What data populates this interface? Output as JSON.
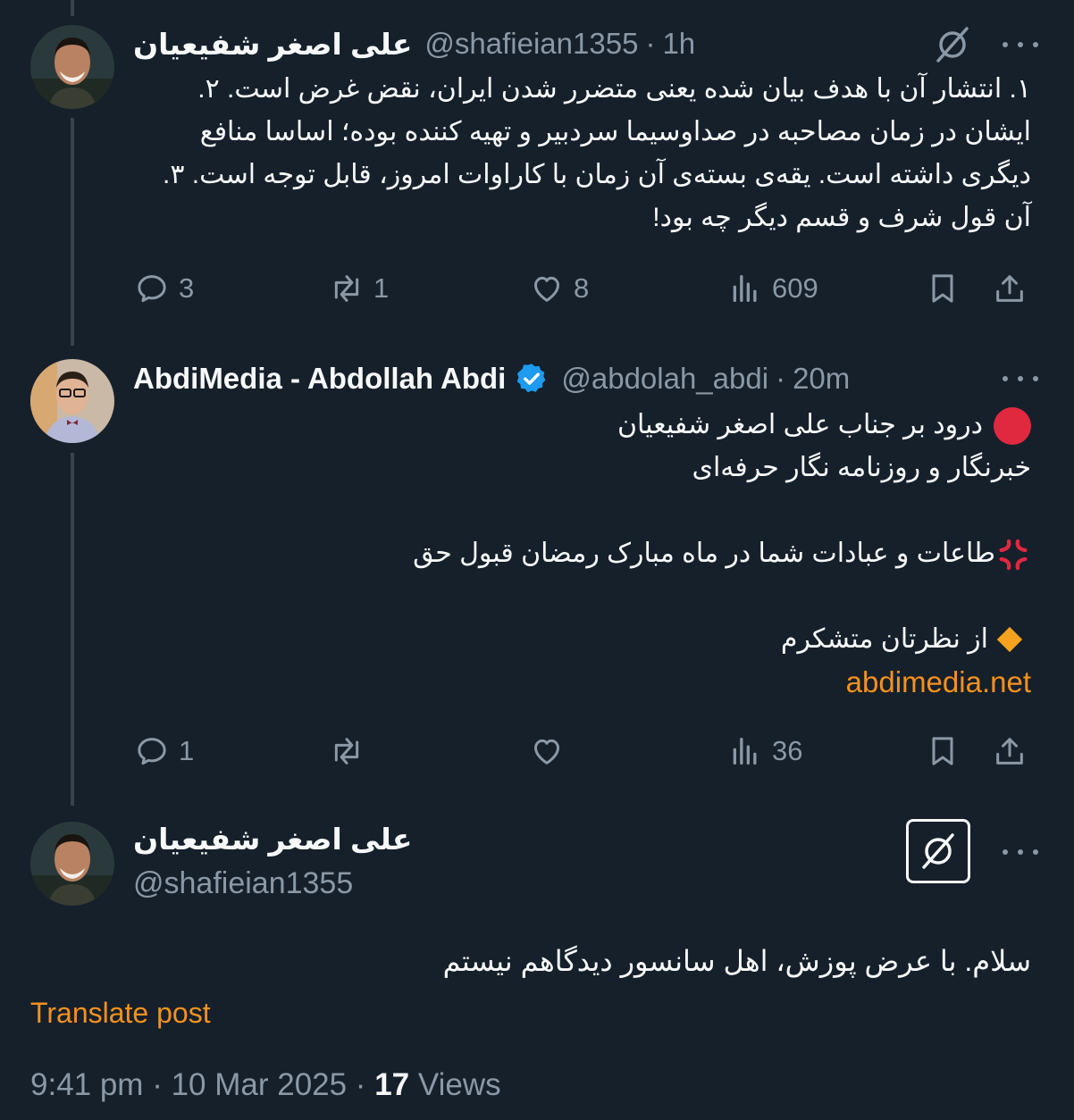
{
  "post1": {
    "author_name": "علی اصغر شفیعیان",
    "handle": "@shafieian1355",
    "separator": "·",
    "time": "1h",
    "text": "۱. انتشار آن با هدف بیان شده یعنی متضرر شدن ایران، نقض غرض است. ۲. ایشان در زمان مصاحبه در صداوسیما سردبیر و تهیه کننده بوده؛ اساسا منافع دیگری داشته است. یقه‌ی بسته‌ی آن زمان با کاراوات امروز، قابل توجه است. ۳. آن قول شرف و قسم دیگر چه بود!",
    "replies": "3",
    "reposts": "1",
    "likes": "8",
    "views": "609"
  },
  "post2": {
    "author_name": "AbdiMedia - Abdollah Abdi",
    "handle": "@abdolah_abdi",
    "separator": "·",
    "time": "20m",
    "line1": "درود بر جناب علی اصغر شفیعیان",
    "line2": "خبرنگار و روزنامه نگار حرفه‌ای",
    "line3": "طاعات و عبادات شما در ماه مبارک رمضان قبول حق",
    "line4": "از نظرتان متشکرم",
    "link": "abdimedia.net",
    "replies": "1",
    "views": "36"
  },
  "post3": {
    "author_name": "علی اصغر شفیعیان",
    "handle": "@shafieian1355",
    "text": "سلام. با عرض پوزش، اهل سانسور دیدگاهم نیستم",
    "translate": "Translate post",
    "timestamp": "9:41 pm · 10 Mar 2025 ·",
    "views_count": "17",
    "views_label": "Views"
  },
  "colors": {
    "background": "#15202b",
    "text": "#f7f9f9",
    "muted": "#8b98a5",
    "accent_orange": "#f5911e",
    "verified_blue": "#1d9bf0"
  }
}
